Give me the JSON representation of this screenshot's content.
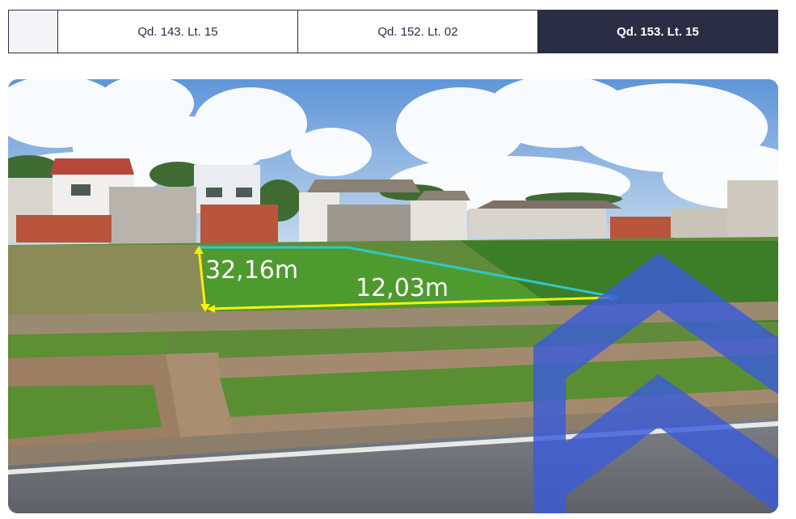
{
  "tabs": [
    {
      "label": ""
    },
    {
      "label": "Qd. 143. Lt. 15"
    },
    {
      "label": "Qd. 152. Lt. 02"
    },
    {
      "label": "Qd. 153. Lt. 15",
      "active": true
    }
  ],
  "photo": {
    "measurement_depth": "32,16m",
    "measurement_front": "12,03m",
    "logo_icon": "house-chevron-logo-icon"
  },
  "colors": {
    "tab_active_bg": "#2b2d45",
    "tab_border": "#2b2d45",
    "measure_front_line": "#f2f20a",
    "measure_side_line": "#2fc8c8",
    "logo_blue": "#3b5bd8"
  }
}
